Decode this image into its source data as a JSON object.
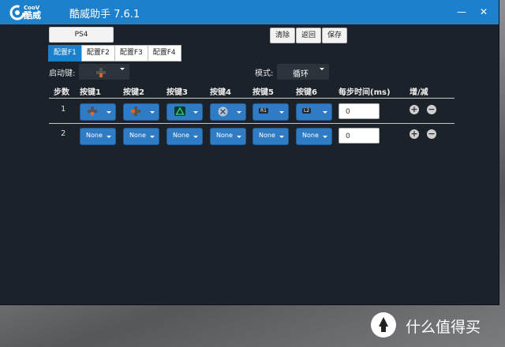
{
  "app": {
    "brand_en": "CooV",
    "brand_cn": "酷威",
    "title": "酷威助手 7.6.1",
    "minimize": "—",
    "close": "✕"
  },
  "toolbar": {
    "mode_button": "PS4",
    "clear": "清除",
    "back": "返回",
    "save": "保存"
  },
  "tabs": [
    "配置F1",
    "配置F2",
    "配置F3",
    "配置F4"
  ],
  "trigger": {
    "label": "启动键:",
    "value": ""
  },
  "mode": {
    "label": "模式:",
    "value": "循环"
  },
  "table": {
    "headers": [
      "步数",
      "按键1",
      "按键2",
      "按键3",
      "按键4",
      "按键5",
      "按键6",
      "每步时间(ms)",
      "增/减"
    ],
    "rows": [
      {
        "step": "1",
        "keys": [
          "dpad-down-icon",
          "dpad-left-icon",
          "triangle-icon",
          "cross-icon",
          "R1",
          "L2"
        ],
        "time": "0"
      },
      {
        "step": "2",
        "keys": [
          "None",
          "None",
          "None",
          "None",
          "None",
          "None"
        ],
        "time": "0"
      }
    ],
    "add": "+",
    "remove": "−"
  },
  "watermark": "什么值得买",
  "colors": {
    "accent": "#1c80cc",
    "window_bg": "#1c222a",
    "key_button": "#2f7cc4"
  }
}
